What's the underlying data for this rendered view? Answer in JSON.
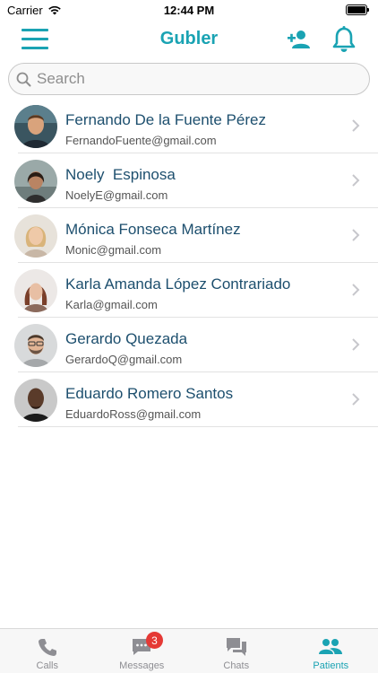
{
  "status_bar": {
    "carrier": "Carrier",
    "time": "12:44 PM"
  },
  "header": {
    "title": "Gubler"
  },
  "search": {
    "placeholder": "Search"
  },
  "patients": [
    {
      "name": "Fernando De la Fuente Pérez",
      "email": "FernandoFuente@gmail.com"
    },
    {
      "name": "Noely  Espinosa",
      "email": "NoelyE@gmail.com"
    },
    {
      "name": "Mónica Fonseca Martínez",
      "email": "Monic@gmail.com"
    },
    {
      "name": "Karla Amanda López Contrariado",
      "email": "Karla@gmail.com"
    },
    {
      "name": "Gerardo Quezada",
      "email": "GerardoQ@gmail.com"
    },
    {
      "name": "Eduardo Romero Santos",
      "email": "EduardoRoss@gmail.com"
    }
  ],
  "tabs": [
    {
      "label": "Calls",
      "icon": "phone-icon"
    },
    {
      "label": "Messages",
      "icon": "message-icon",
      "badge": "3"
    },
    {
      "label": "Chats",
      "icon": "chats-icon"
    },
    {
      "label": "Patients",
      "icon": "patients-icon",
      "active": true
    }
  ],
  "colors": {
    "accent": "#1aa3b3",
    "name_text": "#1d4f6e",
    "badge": "#e53935",
    "inactive_tab": "#8e8e93"
  }
}
